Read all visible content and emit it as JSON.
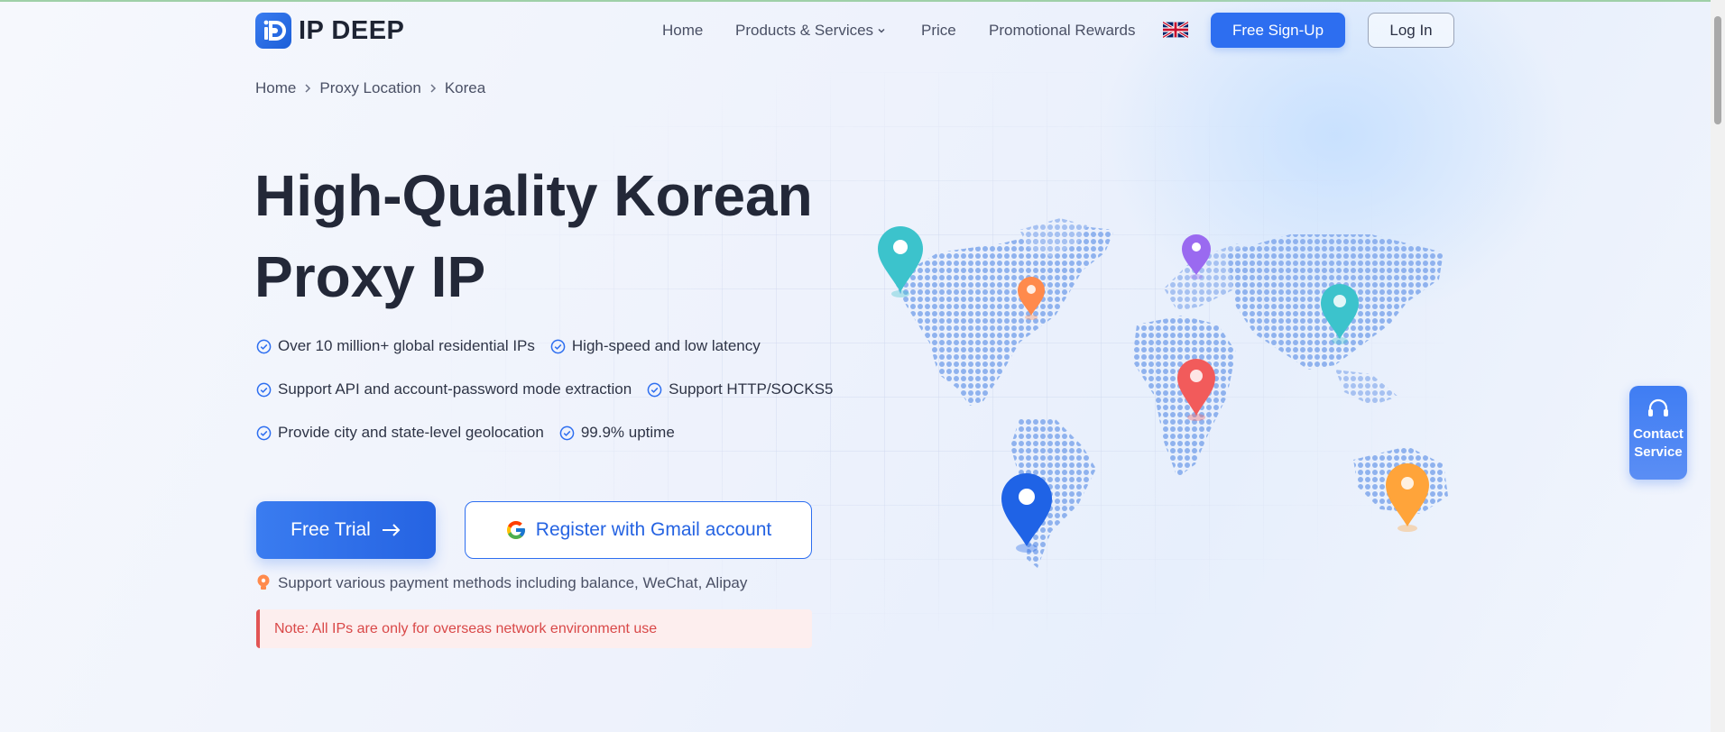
{
  "brand": {
    "name": "IP DEEP"
  },
  "nav": {
    "items": [
      {
        "label": "Home"
      },
      {
        "label": "Products & Services"
      },
      {
        "label": "Price"
      },
      {
        "label": "Promotional Rewards"
      }
    ],
    "signup_label": "Free Sign-Up",
    "login_label": "Log In"
  },
  "breadcrumb": [
    "Home",
    "Proxy Location",
    "Korea"
  ],
  "hero": {
    "title": "High-Quality Korean Proxy IP",
    "features": [
      [
        "Over 10 million+ global residential IPs",
        "High-speed and low latency"
      ],
      [
        "Support API and account-password mode extraction",
        "Support HTTP/SOCKS5"
      ],
      [
        "Provide city and state-level geolocation",
        "99.9% uptime"
      ]
    ],
    "trial_label": "Free Trial",
    "gmail_label": "Register with Gmail account",
    "payment_text": "Support various payment methods including balance, WeChat, Alipay",
    "note_text": "Note: All IPs are only for overseas network environment use"
  },
  "contact": {
    "line1": "Contact",
    "line2": "Service"
  },
  "colors": {
    "primary": "#2d6ef0",
    "note_red": "#d94848",
    "pin_teal": "#3cc3cc",
    "pin_orange": "#ff8a4c",
    "pin_purple": "#9a6af0",
    "pin_red": "#f25b5b",
    "pin_blue": "#1f63e6",
    "pin_amber": "#ffa43a"
  },
  "icons": [
    "logo-icon",
    "chevron-down-icon",
    "uk-flag-icon",
    "check-circle-icon",
    "arrow-right-icon",
    "google-icon",
    "location-pin-icon",
    "headset-icon"
  ]
}
